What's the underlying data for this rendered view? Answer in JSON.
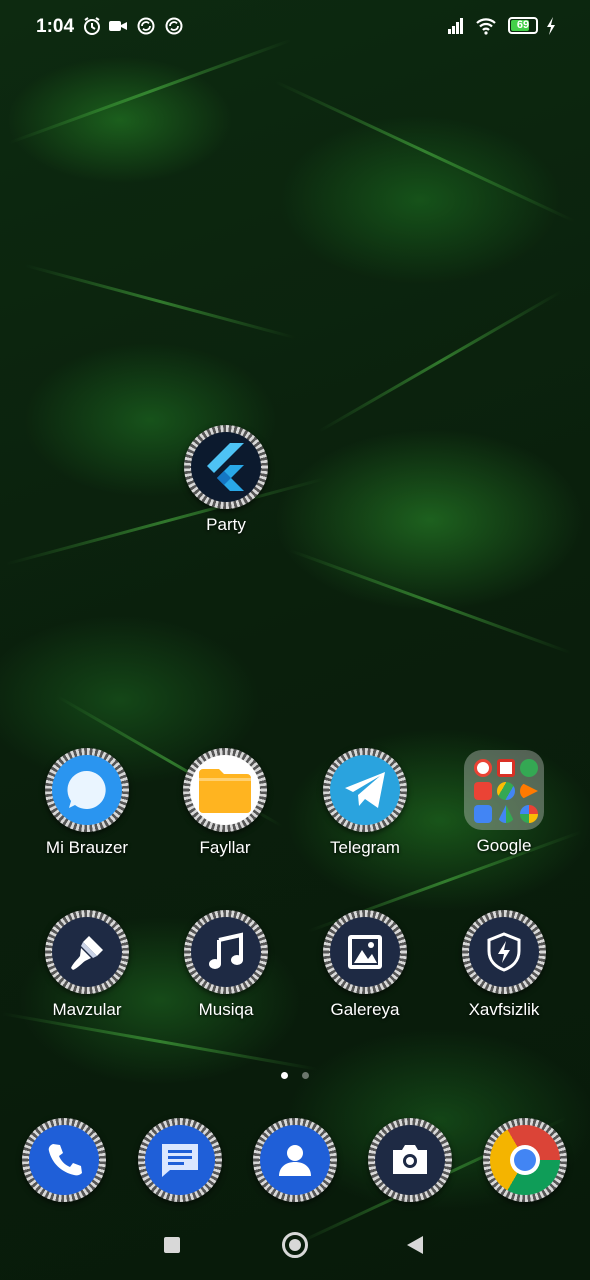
{
  "status_bar": {
    "time": "1:04",
    "left_icons": [
      "alarm-icon",
      "video-camera-icon",
      "sync-icon",
      "sync-icon"
    ],
    "right_icons": [
      "signal-icon",
      "wifi-icon",
      "battery-icon",
      "charging-icon"
    ],
    "battery_level": "69"
  },
  "home": {
    "widget_app": {
      "label": "Party",
      "icon": "flutter-icon"
    },
    "row1": [
      {
        "label": "Mi Brauzer",
        "icon": "browser-bubble-icon"
      },
      {
        "label": "Fayllar",
        "icon": "folder-icon"
      },
      {
        "label": "Telegram",
        "icon": "paper-plane-icon"
      },
      {
        "label": "Google",
        "icon": "folder-google-icon"
      }
    ],
    "row2": [
      {
        "label": "Mavzular",
        "icon": "paintbrush-icon"
      },
      {
        "label": "Musiqa",
        "icon": "music-note-icon"
      },
      {
        "label": "Galereya",
        "icon": "image-icon"
      },
      {
        "label": "Xavfsizlik",
        "icon": "shield-bolt-icon"
      }
    ],
    "page_indicator": {
      "pages": 2,
      "current": 1
    }
  },
  "dock": [
    {
      "name": "phone",
      "icon": "phone-icon"
    },
    {
      "name": "messages",
      "icon": "message-icon"
    },
    {
      "name": "contacts",
      "icon": "person-icon"
    },
    {
      "name": "camera",
      "icon": "camera-icon"
    },
    {
      "name": "chrome",
      "icon": "chrome-icon"
    }
  ],
  "nav_bar": [
    "recents-square-icon",
    "home-circle-icon",
    "back-triangle-icon"
  ],
  "colors": {
    "wallpaper": "#0a1f0c",
    "telegram": "#2aa3de",
    "folder_yellow": "#ffb420",
    "dark_icon": "#1e2a44",
    "phone_blue": "#1f5fd8"
  }
}
